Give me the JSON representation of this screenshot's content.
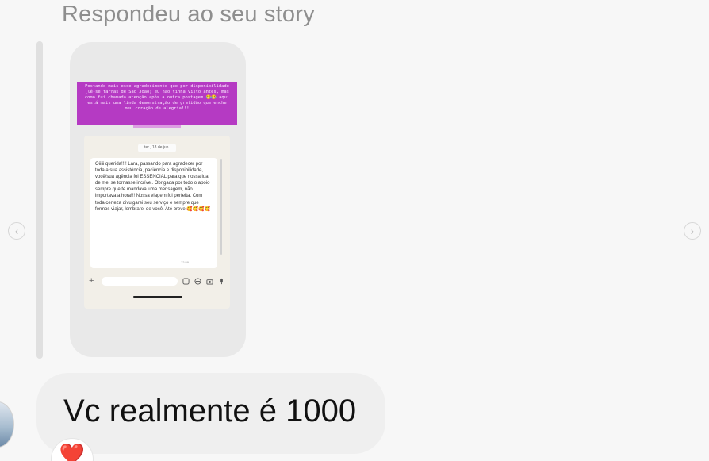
{
  "header": {
    "replied_label": "Respondeu ao seu story"
  },
  "story": {
    "banner_text": "Postando mais esse agradecimento que por disponibilidade (lê-se farras de São João) eu não tinha visto antes, mas como fui chamada atenção após a outra postagem 😂😂 aqui está mais uma linda demonstração de gratidão que enche meu coração de alegria!!!",
    "date_pill": "ter., 18 de jun.",
    "bubble_text": "Oiiiii querida!!!! Lara, passando para agradecer por toda a sua assistência, paciência e disponibilidade, você/sua agência foi ESSENCIAL para que nossa lua de mel se tornasse incrível. Obrigada por todo o apoio sempre que te mandava uma mensagem, não importava a hora!!! Nossa viagem foi perfeita. Com toda certeza divulgarei seu serviço e sempre que formos viajar, lembrarei de você. Até breve 🥰🥰🥰🥰",
    "bubble_time": "12:59",
    "input_plus": "+",
    "icons": [
      "sticker-icon",
      "money-icon",
      "camera-icon",
      "mic-icon"
    ]
  },
  "navigation": {
    "prev_glyph": "‹",
    "next_glyph": "›"
  },
  "message": {
    "text": "Vc realmente é 1000",
    "reaction": "❤️"
  },
  "colors": {
    "background": "#f7f7f7",
    "story_banner": "#b53ac3",
    "bubble": "#efefef",
    "reaction_heart": "#e5212f"
  }
}
